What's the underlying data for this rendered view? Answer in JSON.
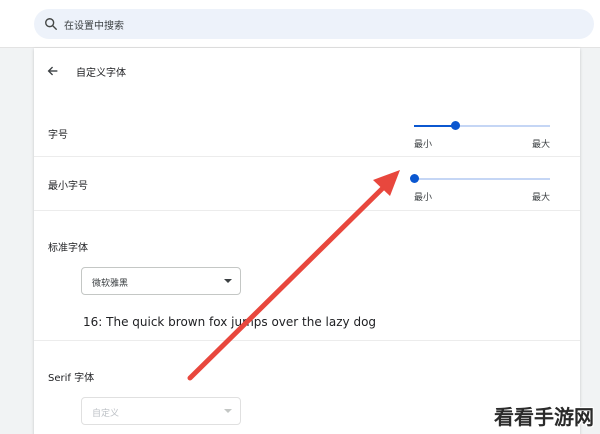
{
  "search": {
    "placeholder": "在设置中搜索",
    "icon": "search-icon"
  },
  "header": {
    "title": "自定义字体",
    "back_icon": "arrow-back-icon"
  },
  "font_size": {
    "label": "字号",
    "min_label": "最小",
    "max_label": "最大",
    "level": 0.3
  },
  "min_font_size": {
    "label": "最小字号",
    "min_label": "最小",
    "max_label": "最大",
    "level": 0.0
  },
  "standard_font": {
    "label": "标准字体",
    "selected": "微软雅黑",
    "sample": "16: The quick brown fox jumps over the lazy dog"
  },
  "serif_font": {
    "label": "Serif 字体",
    "selected": "自定义"
  },
  "annotation": {
    "arrow_color": "#e8473d"
  },
  "watermark": "看看手游网",
  "colors": {
    "accent": "#0b57d0",
    "track": "#c5d6f5"
  }
}
